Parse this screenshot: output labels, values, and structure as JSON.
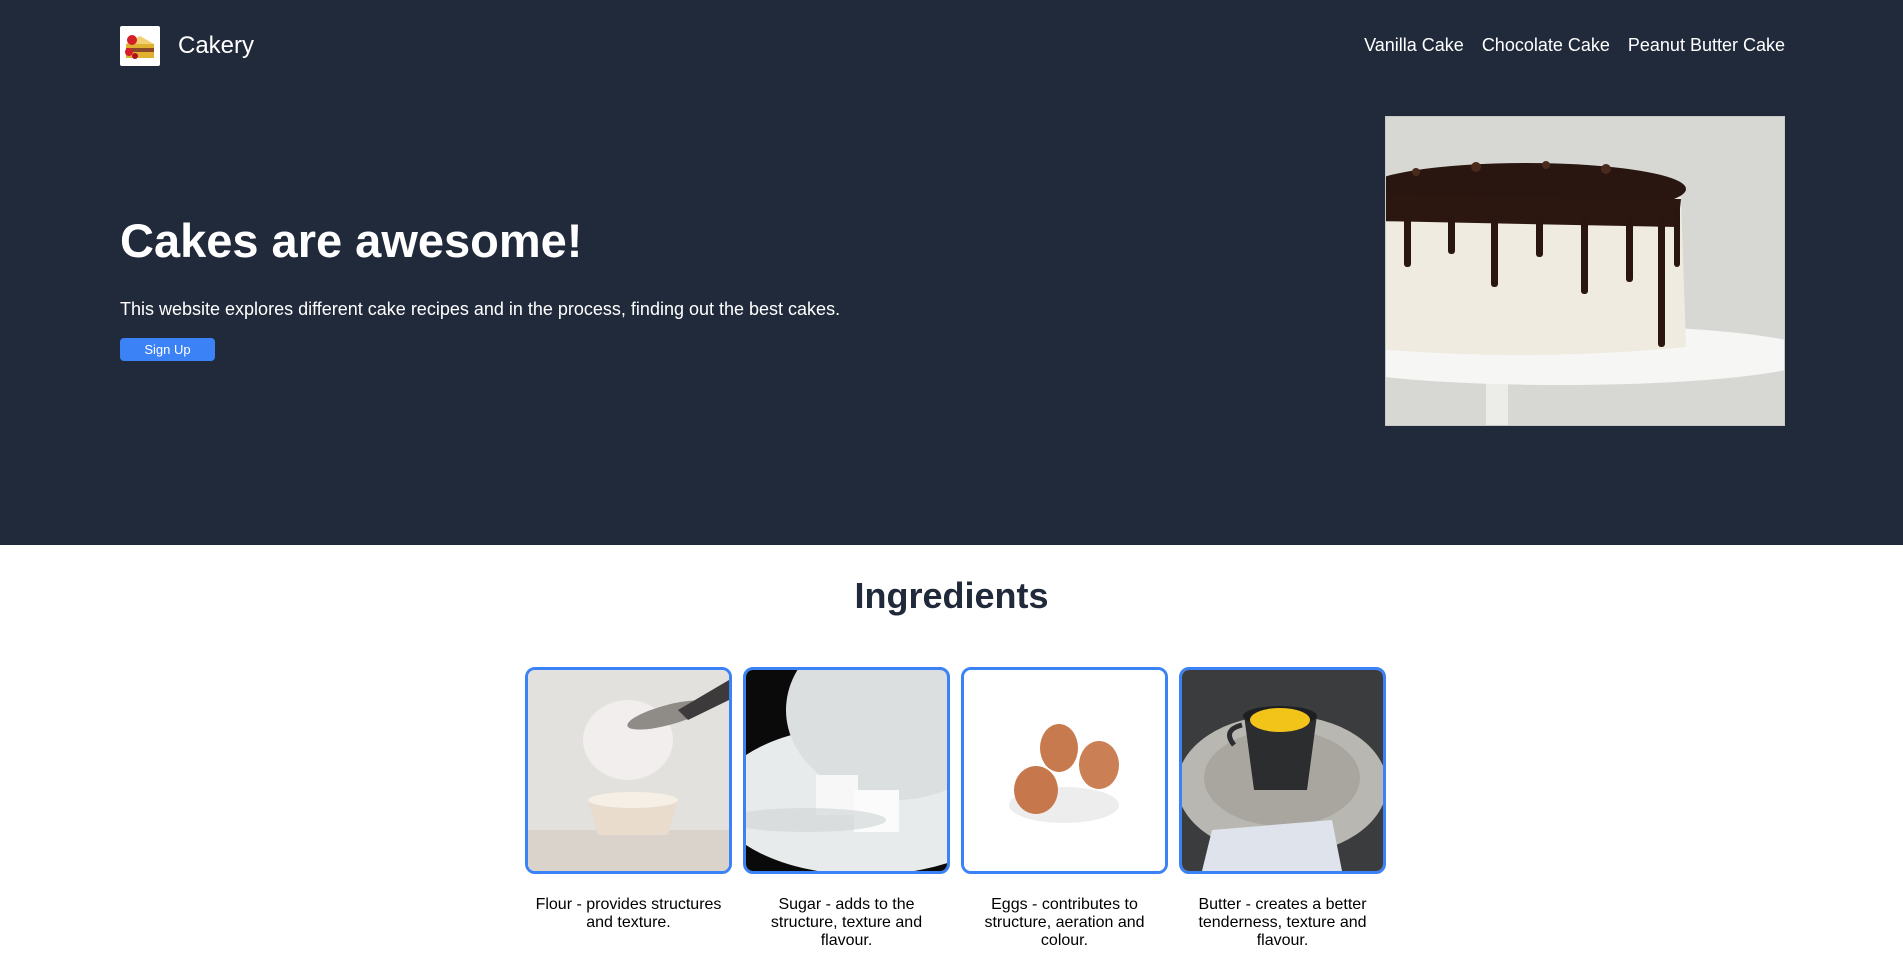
{
  "header": {
    "brand": "Cakery",
    "nav": [
      "Vanilla Cake",
      "Chocolate Cake",
      "Peanut Butter Cake"
    ]
  },
  "hero": {
    "title": "Cakes are awesome!",
    "subtitle": "This website explores different cake recipes and in the process, finding out the best cakes.",
    "signup_label": "Sign Up"
  },
  "ingredients": {
    "title": "Ingredients",
    "items": [
      {
        "caption": "Flour - provides structures and texture."
      },
      {
        "caption": "Sugar - adds to the structure, texture and flavour."
      },
      {
        "caption": "Eggs - contributes to structure, aeration and colour."
      },
      {
        "caption": "Butter - creates a better tenderness, texture and flavour."
      }
    ]
  },
  "colors": {
    "hero_bg": "#212a3b",
    "accent": "#3b82f6",
    "heading_dark": "#212a3b"
  }
}
